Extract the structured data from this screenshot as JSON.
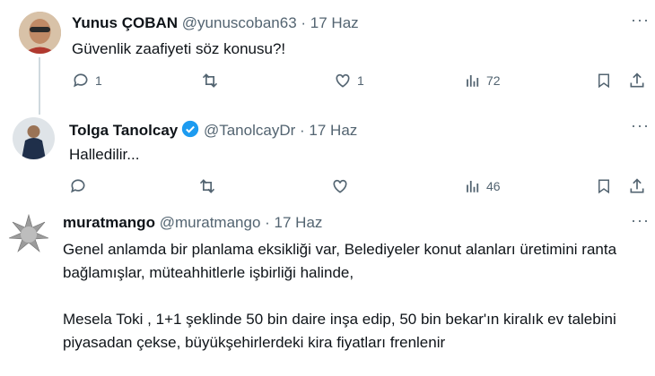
{
  "tweets": [
    {
      "name": "Yunus ÇOBAN",
      "handle": "@yunuscoban63",
      "sep": "·",
      "date": "17 Haz",
      "text": "Güvenlik zaafiyeti söz konusu?!",
      "replies": "1",
      "retweets": "",
      "likes": "1",
      "views": "72"
    },
    {
      "name": "Tolga Tanolcay",
      "handle": "@TanolcayDr",
      "sep": "·",
      "date": "17 Haz",
      "text": "Halledilir...",
      "replies": "",
      "retweets": "",
      "likes": "",
      "views": "46"
    },
    {
      "name": "muratmango",
      "handle": "@muratmango",
      "sep": "·",
      "date": "17 Haz",
      "text_p1": "Genel anlamda bir planlama eksikliği var, Belediyeler konut alanları üretimini ranta bağlamışlar, müteahhitlerle işbirliği halinde,",
      "text_p2": "Mesela Toki , 1+1 şeklinde 50 bin daire inşa edip, 50 bin bekar'ın kiralık ev talebini piyasadan çekse, büyükşehirlerdeki kira fiyatları frenlenir"
    }
  ],
  "colors": {
    "verified": "#1d9bf0",
    "muted": "#536471",
    "text": "#0f1419"
  },
  "icons": [
    "reply-icon",
    "retweet-icon",
    "like-icon",
    "views-icon",
    "bookmark-icon",
    "share-icon",
    "more-icon",
    "verified-icon"
  ]
}
